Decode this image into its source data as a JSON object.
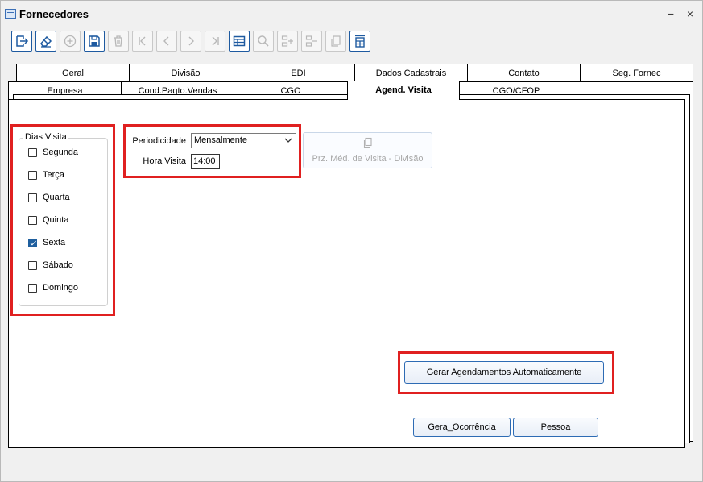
{
  "window": {
    "title": "Fornecedores",
    "minimize_glyph": "−",
    "close_glyph": "×"
  },
  "toolbar": {
    "buttons": [
      {
        "icon": "exit-icon",
        "enabled": true
      },
      {
        "icon": "eraser-icon",
        "enabled": true
      },
      {
        "icon": "add-icon",
        "enabled": false
      },
      {
        "icon": "save-icon",
        "enabled": true
      },
      {
        "icon": "delete-icon",
        "enabled": false
      },
      {
        "icon": "first-record-icon",
        "enabled": false
      },
      {
        "icon": "previous-record-icon",
        "enabled": false
      },
      {
        "icon": "next-record-icon",
        "enabled": false
      },
      {
        "icon": "last-record-icon",
        "enabled": false
      },
      {
        "icon": "grid-view-icon",
        "enabled": true
      },
      {
        "icon": "search-icon",
        "enabled": false
      },
      {
        "icon": "insert-row-icon",
        "enabled": false
      },
      {
        "icon": "remove-row-icon",
        "enabled": false
      },
      {
        "icon": "copy-icon",
        "enabled": false
      },
      {
        "icon": "calculator-icon",
        "enabled": true
      }
    ]
  },
  "tabs": {
    "row1": [
      "Geral",
      "Divisão",
      "EDI",
      "Dados Cadastrais",
      "Contato",
      "Seg. Fornec"
    ],
    "row2": [
      "Empresa",
      "Cond.Pagto.Vendas",
      "CGO",
      "Agend. Visita",
      "CGO/CFOP"
    ],
    "active": "Agend. Visita"
  },
  "dias_visita": {
    "title": "Dias Visita",
    "days": [
      {
        "label": "Segunda",
        "checked": false
      },
      {
        "label": "Terça",
        "checked": false
      },
      {
        "label": "Quarta",
        "checked": false
      },
      {
        "label": "Quinta",
        "checked": false
      },
      {
        "label": "Sexta",
        "checked": true
      },
      {
        "label": "Sábado",
        "checked": false
      },
      {
        "label": "Domingo",
        "checked": false
      }
    ]
  },
  "form": {
    "periodicidade_label": "Periodicidade",
    "periodicidade_value": "Mensalmente",
    "hora_visita_label": "Hora Visita",
    "hora_visita_value": "14:00"
  },
  "buttons": {
    "prz_medio": "Prz. Méd. de Visita - Divisão",
    "gerar_agendamentos": "Gerar Agendamentos Automaticamente",
    "gera_ocorrencia": "Gera_Ocorrência",
    "pessoa": "Pessoa"
  },
  "colors": {
    "highlight": "#e02020",
    "accent": "#1e5aa0",
    "checkbox_checked": "#1f5f9e",
    "disabled_text": "#a8a8a8"
  }
}
